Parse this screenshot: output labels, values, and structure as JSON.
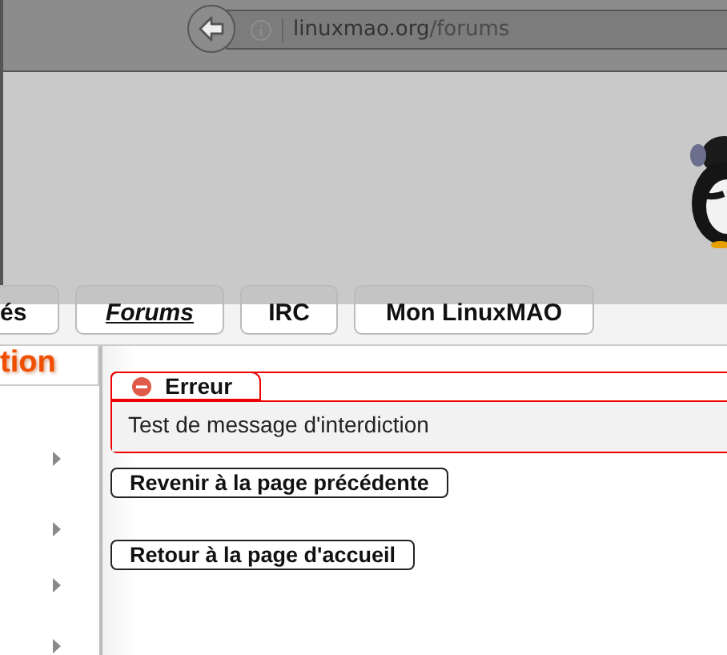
{
  "browser": {
    "url_host": "linuxmao.org",
    "url_path": "/forums"
  },
  "nav_tabs": [
    {
      "label": "és",
      "selected": false
    },
    {
      "label": "Forums",
      "selected": true
    },
    {
      "label": "IRC",
      "selected": false
    },
    {
      "label": "Mon LinuxMAO",
      "selected": false
    }
  ],
  "sidebar": {
    "title": "tion",
    "items": [
      {
        "kind": "submenu"
      },
      {
        "kind": "submenu"
      },
      {
        "kind": "submenu"
      },
      {
        "kind": "submenu"
      }
    ]
  },
  "error": {
    "title": "Erreur",
    "message": "Test de message d'interdiction"
  },
  "buttons": [
    "Revenir à la page précédente",
    "Retour à la page d'accueil"
  ]
}
